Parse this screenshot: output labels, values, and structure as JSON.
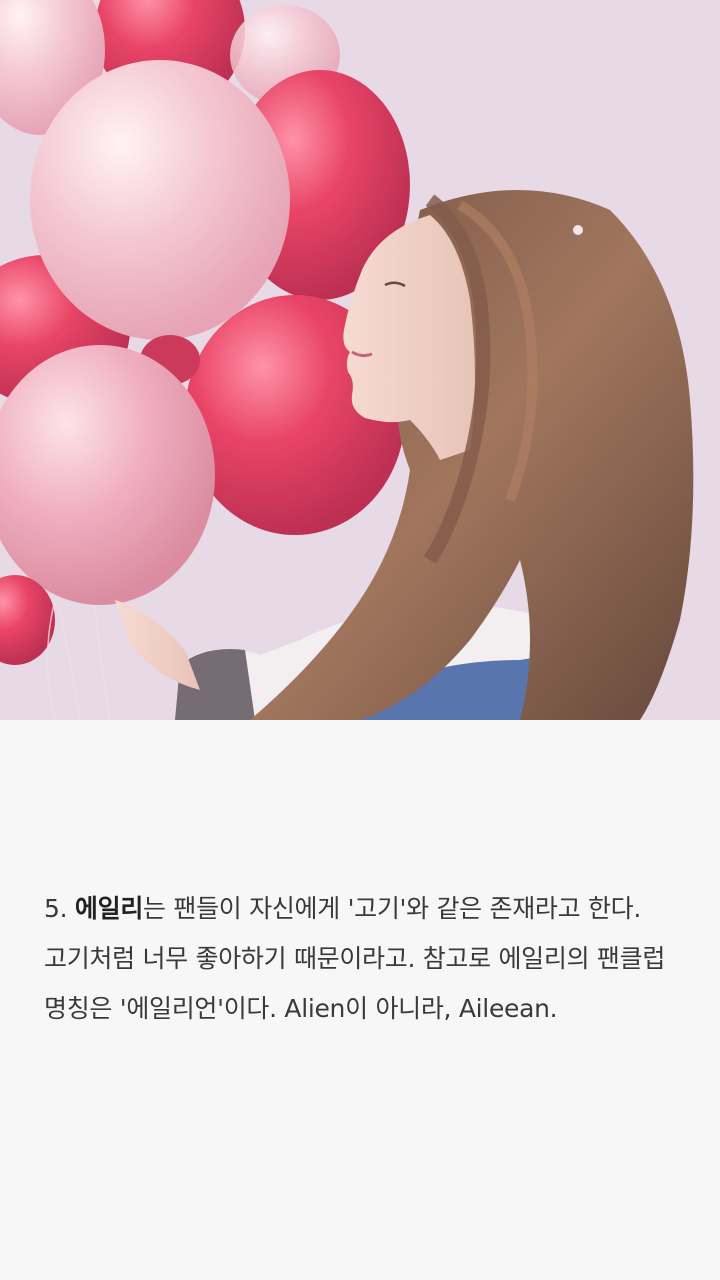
{
  "article": {
    "item_number": "5.",
    "name": "에일리",
    "text_part1": "는 팬들이 자신에게 '고기'와 같은 존재라고 한다. 고기처럼 너무 좋아하기 때문이라고. 참고로 에일리의 팬클럽 명칭은 '에일리언'이다. Alien이 아니라, Aileean."
  },
  "photo": {
    "subject": "woman-with-balloons",
    "colors": {
      "background": "#e6d3e3",
      "balloon_red": "#e8355a",
      "balloon_pink": "#f2b6c6",
      "hair": "#8a5a44",
      "jacket": "#4a6aa8"
    }
  }
}
